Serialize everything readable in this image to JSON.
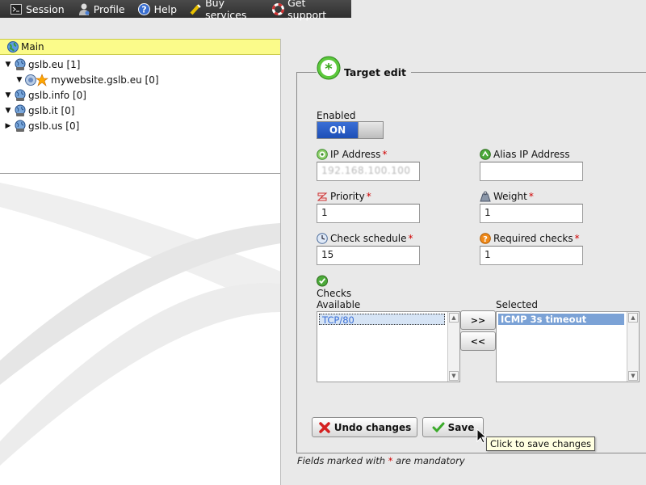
{
  "menubar": {
    "items": [
      {
        "label": "Session",
        "icon": "terminal-icon"
      },
      {
        "label": "Profile",
        "icon": "user-icon"
      },
      {
        "label": "Help",
        "icon": "help-icon"
      },
      {
        "label": "Buy services",
        "icon": "cart-icon"
      },
      {
        "label": "Get support",
        "icon": "lifebuoy-icon"
      }
    ]
  },
  "tree": {
    "header": "Main",
    "items": [
      {
        "label": "gslb.eu [1]",
        "expanded": true
      },
      {
        "label": "mywebsite.gslb.eu [0]",
        "expanded": true
      },
      {
        "label": "gslb.info [0]",
        "expanded": true
      },
      {
        "label": "gslb.it [0]",
        "expanded": true
      },
      {
        "label": "gslb.us [0]",
        "expanded": false
      }
    ]
  },
  "form": {
    "title": "Target edit",
    "enabled_label": "Enabled",
    "enabled_value": "ON",
    "ip_label": "IP Address",
    "ip_value": "192.168.100.100",
    "alias_label": "Alias IP Address",
    "alias_value": "",
    "priority_label": "Priority",
    "priority_value": "1",
    "weight_label": "Weight",
    "weight_value": "1",
    "schedule_label": "Check schedule",
    "schedule_value": "15",
    "required_label": "Required checks",
    "required_value": "1",
    "checks_label": "Checks",
    "available_label": "Available",
    "selected_label": "Selected",
    "available_options": [
      "TCP/80"
    ],
    "selected_options": [
      "ICMP 3s timeout"
    ],
    "add_label": ">>",
    "remove_label": "<<",
    "undo_label": "Undo changes",
    "save_label": "Save",
    "required_mark": "*"
  },
  "tooltip": "Click to save changes",
  "footnote": {
    "pre": "Fields marked with",
    "star": "*",
    "post": "are mandatory"
  },
  "colors": {
    "tree_header": "#fbfb8a",
    "toggle_on": "#2a5cc8",
    "required": "#d00000",
    "selected_option": "#7ba2d6"
  }
}
